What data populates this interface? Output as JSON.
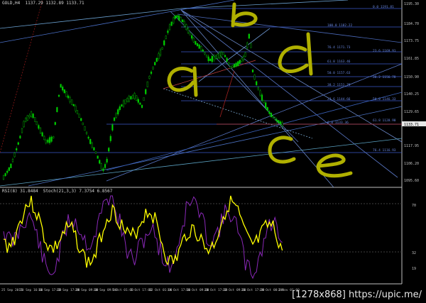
{
  "header": {
    "symbol_line": "GOLD,H4  1137.29 1132.89 1133.71"
  },
  "indicator": {
    "label": "RSI(8) 31.8484  Stoch(21,3,3) 7.3754 6.8567"
  },
  "price_axis": {
    "ticks": [
      "1195.30",
      "1184.70",
      "1173.75",
      "1161.85",
      "1150.90",
      "1140.25",
      "1129.65",
      "1117.95",
      "1106.20",
      "1095.60"
    ],
    "current_price": "1133.71"
  },
  "indicator_axis": {
    "ticks": [
      "70",
      "32",
      "19"
    ]
  },
  "time_axis": {
    "ticks": [
      "25 Sep 2015",
      "30 Sep 16:00",
      "16 Sep 17:00",
      "22 Sep 17:00",
      "28 Sep 09:00",
      "30 Sep 09:00",
      "5 Oct 01:00",
      "7 Oct 17:00",
      "12 Oct 01:00",
      "14 Oct 17:00",
      "16 Oct 09:00",
      "20 Oct 17:00",
      "22 Oct 09:00",
      "26 Oct 17:00",
      "29 Oct 00:00",
      "2 Nov 01:00"
    ]
  },
  "fibo_levels": [
    {
      "label": "0.0  1191.81"
    },
    {
      "label": "100.0  1182.22"
    },
    {
      "label": "76.4  1171.73"
    },
    {
      "label": "61.8  1163.46"
    },
    {
      "label": "50.0  1157.63"
    },
    {
      "label": "38.2  1151.79"
    },
    {
      "label": "23.6  1144.66"
    },
    {
      "label": "0.0  1133.36"
    },
    {
      "label": "23.6  1169.91"
    },
    {
      "label": "38.2  1156.78"
    },
    {
      "label": "50.0  1146.33"
    },
    {
      "label": "61.8  1128.90"
    },
    {
      "label": "76.4  1116.93"
    }
  ],
  "annotations": [
    "b",
    "d",
    "a",
    "c",
    "e"
  ],
  "colors": {
    "bull": "#00c800",
    "bear": "#00c800",
    "rsi": "#ffff00",
    "stoch": "#9b30c8",
    "fib": "#4a68d8",
    "annot": "#b8b800"
  },
  "watermark": "[1278x868]  https://upic.me/"
}
